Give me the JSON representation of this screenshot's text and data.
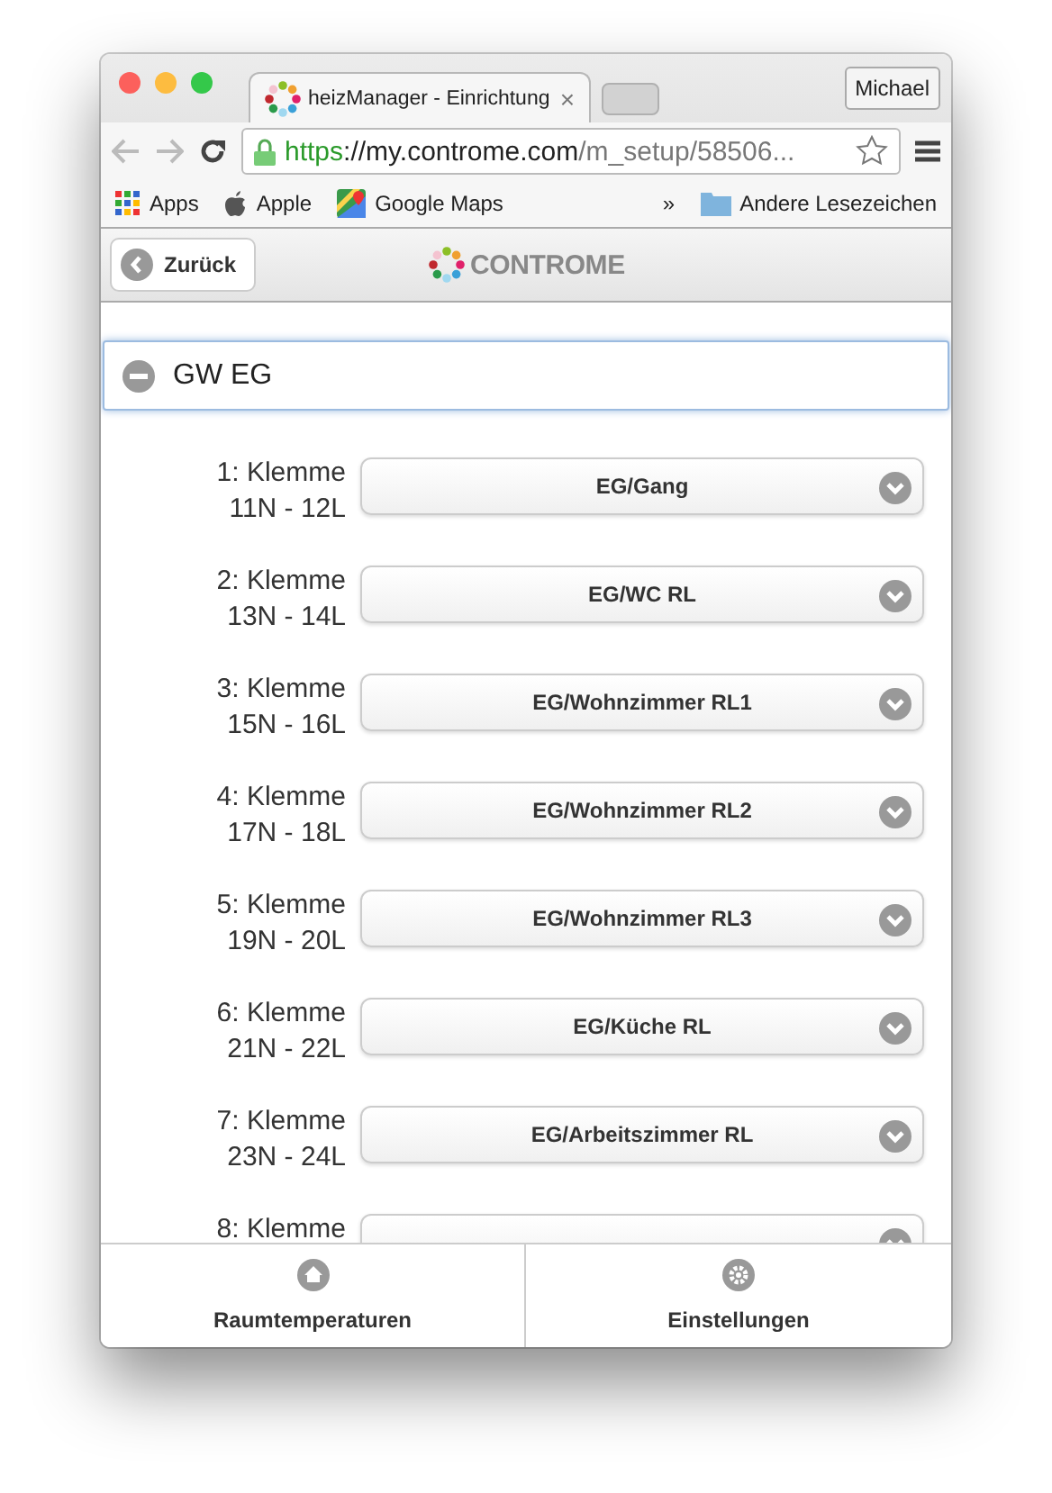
{
  "window": {
    "tab_title": "heizManager - Einrichtung",
    "tab_close": "×",
    "profile": "Michael"
  },
  "address_bar": {
    "scheme": "https",
    "rest": "://my.controme.com",
    "path": "/m_setup/58506..."
  },
  "bookmarks": [
    {
      "label": "Apps",
      "kind": "apps"
    },
    {
      "label": "Apple",
      "kind": "apple"
    },
    {
      "label": "Google Maps",
      "kind": "maps"
    }
  ],
  "bookmarks_more": "»",
  "bookmarks_folder": "Andere Lesezeichen",
  "header": {
    "back": "Zurück",
    "logo": "CONTROME"
  },
  "section": {
    "title": "GW EG",
    "expanded": true
  },
  "rows": [
    {
      "label": [
        "1: Klemme",
        "11N - 12L"
      ],
      "value": "EG/Gang"
    },
    {
      "label": [
        "2: Klemme",
        "13N - 14L"
      ],
      "value": "EG/WC RL"
    },
    {
      "label": [
        "3: Klemme",
        "15N - 16L"
      ],
      "value": "EG/Wohnzimmer RL1"
    },
    {
      "label": [
        "4: Klemme",
        "17N - 18L"
      ],
      "value": "EG/Wohnzimmer RL2"
    },
    {
      "label": [
        "5: Klemme",
        "19N - 20L"
      ],
      "value": "EG/Wohnzimmer RL3"
    },
    {
      "label": [
        "6: Klemme",
        "21N - 22L"
      ],
      "value": "EG/Küche RL"
    },
    {
      "label": [
        "7: Klemme",
        "23N - 24L"
      ],
      "value": "EG/Arbeitszimmer RL"
    },
    {
      "label": [
        "8: Klemme"
      ]
    }
  ],
  "footer": [
    {
      "label": "Raumtemperaturen",
      "kind": "home"
    },
    {
      "label": "Einstellungen",
      "kind": "gear"
    }
  ]
}
